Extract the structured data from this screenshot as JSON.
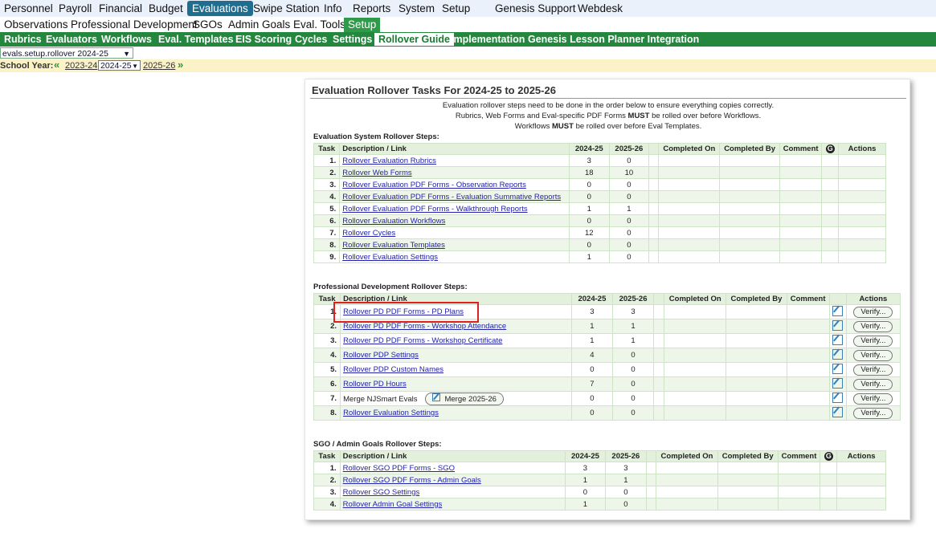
{
  "top_nav": {
    "items": [
      "Personnel",
      "Payroll",
      "Financial",
      "Budget",
      "Evaluations",
      "Swipe Station",
      "Info",
      "Reports",
      "System",
      "Setup",
      "Genesis Support",
      "Webdesk"
    ],
    "active": "Evaluations"
  },
  "sub_nav": {
    "items": [
      "Observations",
      "Professional Development",
      "SGOs",
      "Admin Goals",
      "Eval. Tools",
      "Setup"
    ],
    "active": "Setup"
  },
  "setup_nav": {
    "items": [
      "Rubrics",
      "Evaluators",
      "Workflows",
      "Eval. Templates",
      "EIS Scoring",
      "Cycles",
      "Settings",
      "Rollover Guide",
      "Implementation",
      "Genesis Lesson Planner Integration"
    ],
    "active": "Rollover Guide"
  },
  "screen_select": {
    "value": "evals.setup.rollover 2024-25"
  },
  "school_year": {
    "label": "School Year:",
    "prev": "2023-24",
    "current": "2024-25",
    "next": "2025-26"
  },
  "panel": {
    "title": "Evaluation Rollover Tasks For 2024-25 to 2025-26",
    "intro_lines": [
      "Evaluation rollover steps need to be done in the order below to ensure everything copies correctly.",
      "Rubrics, Web Forms and Eval-specific PDF Forms MUST be rolled over before Workflows.",
      "Workflows MUST be rolled over before Eval Templates."
    ]
  },
  "columns": {
    "task": "Task",
    "desc": "Description / Link",
    "y1": "2024-25",
    "y2": "2025-26",
    "completed_on": "Completed On",
    "completed_by": "Completed By",
    "comment": "Comment",
    "g": "G",
    "actions": "Actions"
  },
  "eval_section": {
    "title": "Evaluation System Rollover Steps:",
    "rows": [
      {
        "task": "1.",
        "desc": "Rollover Evaluation Rubrics",
        "y1": "3",
        "y2": "0"
      },
      {
        "task": "2.",
        "desc": "Rollover Web Forms",
        "y1": "18",
        "y2": "10"
      },
      {
        "task": "3.",
        "desc": "Rollover Evaluation PDF Forms - Observation Reports",
        "y1": "0",
        "y2": "0"
      },
      {
        "task": "4.",
        "desc": "Rollover Evaluation PDF Forms - Evaluation Summative Reports",
        "y1": "0",
        "y2": "0"
      },
      {
        "task": "5.",
        "desc": "Rollover Evaluation PDF Forms - Walkthrough Reports",
        "y1": "1",
        "y2": "1"
      },
      {
        "task": "6.",
        "desc": "Rollover Evaluation Workflows",
        "y1": "0",
        "y2": "0"
      },
      {
        "task": "7.",
        "desc": "Rollover Cycles",
        "y1": "12",
        "y2": "0"
      },
      {
        "task": "8.",
        "desc": "Rollover Evaluation Templates",
        "y1": "0",
        "y2": "0"
      },
      {
        "task": "9.",
        "desc": "Rollover Evaluation Settings",
        "y1": "1",
        "y2": "0"
      }
    ]
  },
  "pd_section": {
    "title": "Professional Development Rollover Steps:",
    "verify_label": "Verify...",
    "rows": [
      {
        "task": "1.",
        "desc": "Rollover PD PDF Forms - PD Plans",
        "y1": "3",
        "y2": "3",
        "link": true
      },
      {
        "task": "2.",
        "desc": "Rollover PD PDF Forms - Workshop Attendance",
        "y1": "1",
        "y2": "1",
        "link": true
      },
      {
        "task": "3.",
        "desc": "Rollover PD PDF Forms - Workshop Certificate",
        "y1": "1",
        "y2": "1",
        "link": true
      },
      {
        "task": "4.",
        "desc": "Rollover PDP Settings",
        "y1": "4",
        "y2": "0",
        "link": true
      },
      {
        "task": "5.",
        "desc": "Rollover PDP Custom Names",
        "y1": "0",
        "y2": "0",
        "link": true
      },
      {
        "task": "6.",
        "desc": "Rollover PD Hours",
        "y1": "7",
        "y2": "0",
        "link": true
      },
      {
        "task": "7.",
        "desc": "Merge NJSmart Evals",
        "y1": "0",
        "y2": "0",
        "link": false,
        "button": "Merge 2025-26"
      },
      {
        "task": "8.",
        "desc": "Rollover Evaluation Settings",
        "y1": "0",
        "y2": "0",
        "link": true
      }
    ]
  },
  "sgo_section": {
    "title": "SGO / Admin Goals Rollover Steps:",
    "rows": [
      {
        "task": "1.",
        "desc": "Rollover SGO PDF Forms - SGO",
        "y1": "3",
        "y2": "3"
      },
      {
        "task": "2.",
        "desc": "Rollover SGO PDF Forms - Admin Goals",
        "y1": "1",
        "y2": "1"
      },
      {
        "task": "3.",
        "desc": "Rollover SGO Settings",
        "y1": "0",
        "y2": "0"
      },
      {
        "task": "4.",
        "desc": "Rollover Admin Goal Settings",
        "y1": "1",
        "y2": "0"
      }
    ]
  },
  "highlight": {
    "target": "Rollover PD PDF Forms - PD Plans",
    "color": "#e01f1f"
  }
}
